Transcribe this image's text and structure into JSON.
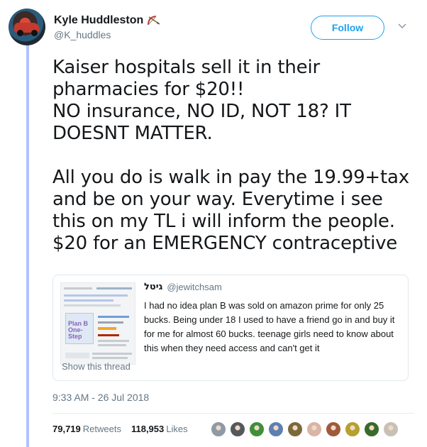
{
  "tweet": {
    "display_name": "Kyle Huddleston",
    "name_emoji": "bow-and-arrow-icon",
    "handle": "@K_huddles",
    "follow_label": "Follow",
    "text": "Kaiser hospitals sell it in their pharmacies for $20!!\nNO insurance, NO ID, NOT 18? IT DOESNT MATTER.\n\nAll you do is walk in pay the 19.99+tax and be on your way. Everytime i see this on my TL i will inform the people. $20 for an EMERGENCY contraceptive",
    "timestamp": "9:33 AM - 26 Jul 2018",
    "retweets_count": "79,719",
    "retweets_label": "Retweets",
    "likes_count": "118,953",
    "likes_label": "Likes"
  },
  "quoted": {
    "name": "גיטל",
    "handle": "@jewitchsam",
    "text": "I had no idea plan B was sold on amazon prime for only 25 bucks. Being under 18 I used to have a friend go in and buy it for me for almost 60 bucks. teenage girls need to know about this when they need access and can't get it",
    "show_thread": "Show this thread",
    "image_box_label": "Plan B One-Step"
  },
  "colors": {
    "accent": "#1da1f2",
    "thread_line": "#b3c2ff",
    "muted": "#657786"
  },
  "liker_colors": [
    "#8e9aa6",
    "#55595c",
    "#3f8f3a",
    "#5e7fb0",
    "#7a6a3a",
    "#d9b5a5",
    "#a05a3a",
    "#b5a030",
    "#3a6a2a",
    "#c9c0b5"
  ]
}
